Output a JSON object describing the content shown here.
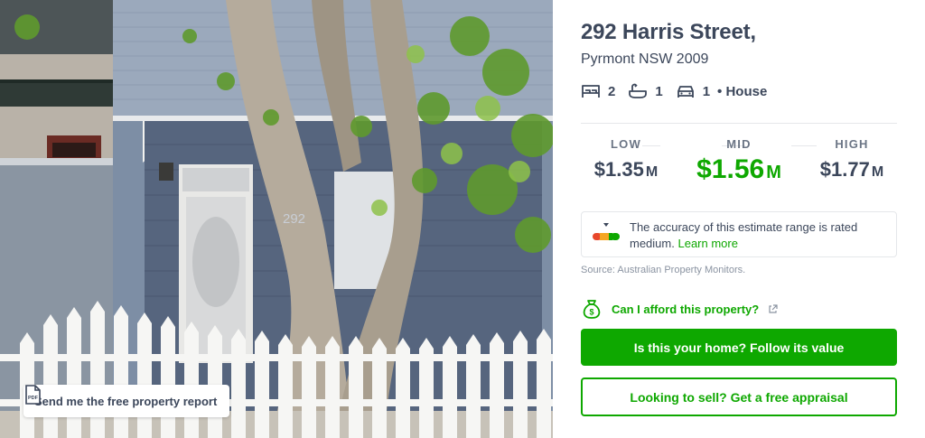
{
  "photo": {
    "house_number": "292",
    "report_button_label": "Send me the free property report",
    "pdf_icon_text": "PDF"
  },
  "property": {
    "address_line1": "292 Harris Street,",
    "address_line2": "Pyrmont NSW 2009",
    "bedrooms": "2",
    "bathrooms": "1",
    "parking": "1",
    "separator": "•",
    "type": "House"
  },
  "estimate": {
    "low_label": "LOW",
    "low_value": "$1.35",
    "low_unit": "M",
    "mid_label": "MID",
    "mid_value": "$1.56",
    "mid_unit": "M",
    "high_label": "HIGH",
    "high_value": "$1.77",
    "high_unit": "M",
    "mid_color": "#0ea800"
  },
  "accuracy": {
    "text": "The accuracy of this estimate range is rated medium.",
    "link": "Learn more",
    "gauge_colors": [
      "#e8472b",
      "#f5a623",
      "#0ea800"
    ]
  },
  "source": "Source: Australian Property Monitors.",
  "actions": {
    "afford_label": "Can I afford this property?",
    "follow_label": "Is this your home? Follow its value",
    "appraisal_label": "Looking to sell? Get a free appraisal"
  },
  "colors": {
    "brand_green": "#0ea800",
    "text_dark": "#3c475b"
  }
}
